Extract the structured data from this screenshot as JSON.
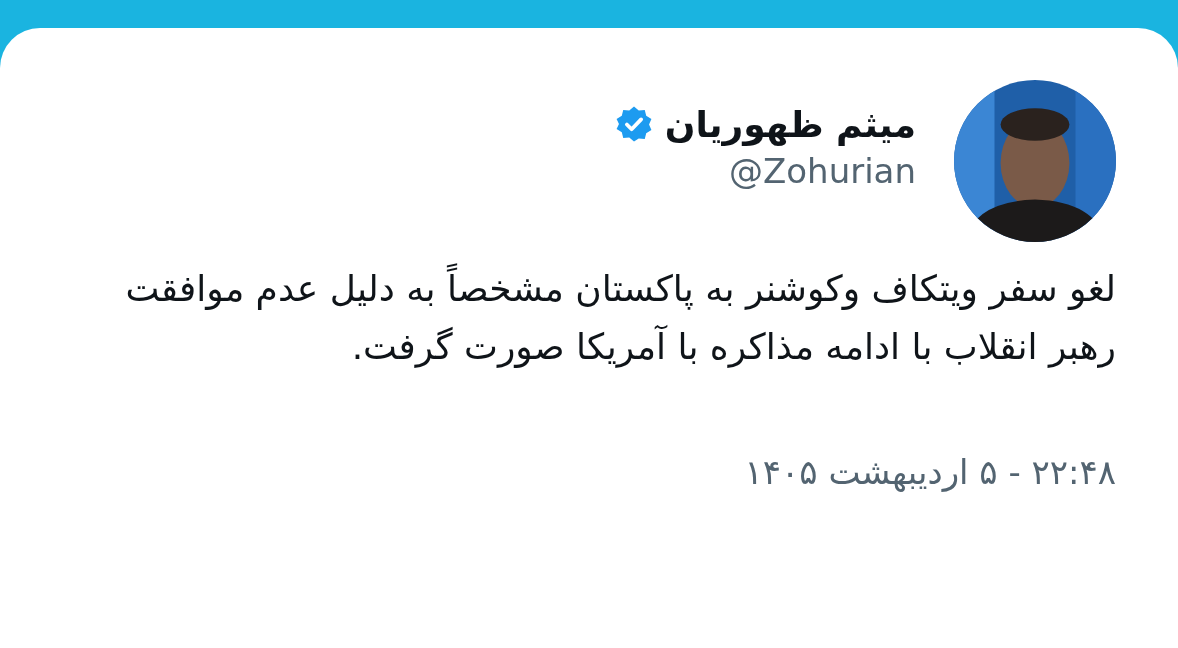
{
  "tweet": {
    "author": {
      "name": "میثم ظهوریان",
      "verified": true,
      "handle": "@Zohurian"
    },
    "text": "لغو سفر ویتکاف وکوشنر به پاکستان مشخصاً به دلیل عدم موافقت رهبر انقلاب با ادامه مذاکره با آمریکا صورت گرفت.",
    "timestamp": "۲۲:۴۸ - ۵ اردیبهشت ۱۴۰۵"
  }
}
